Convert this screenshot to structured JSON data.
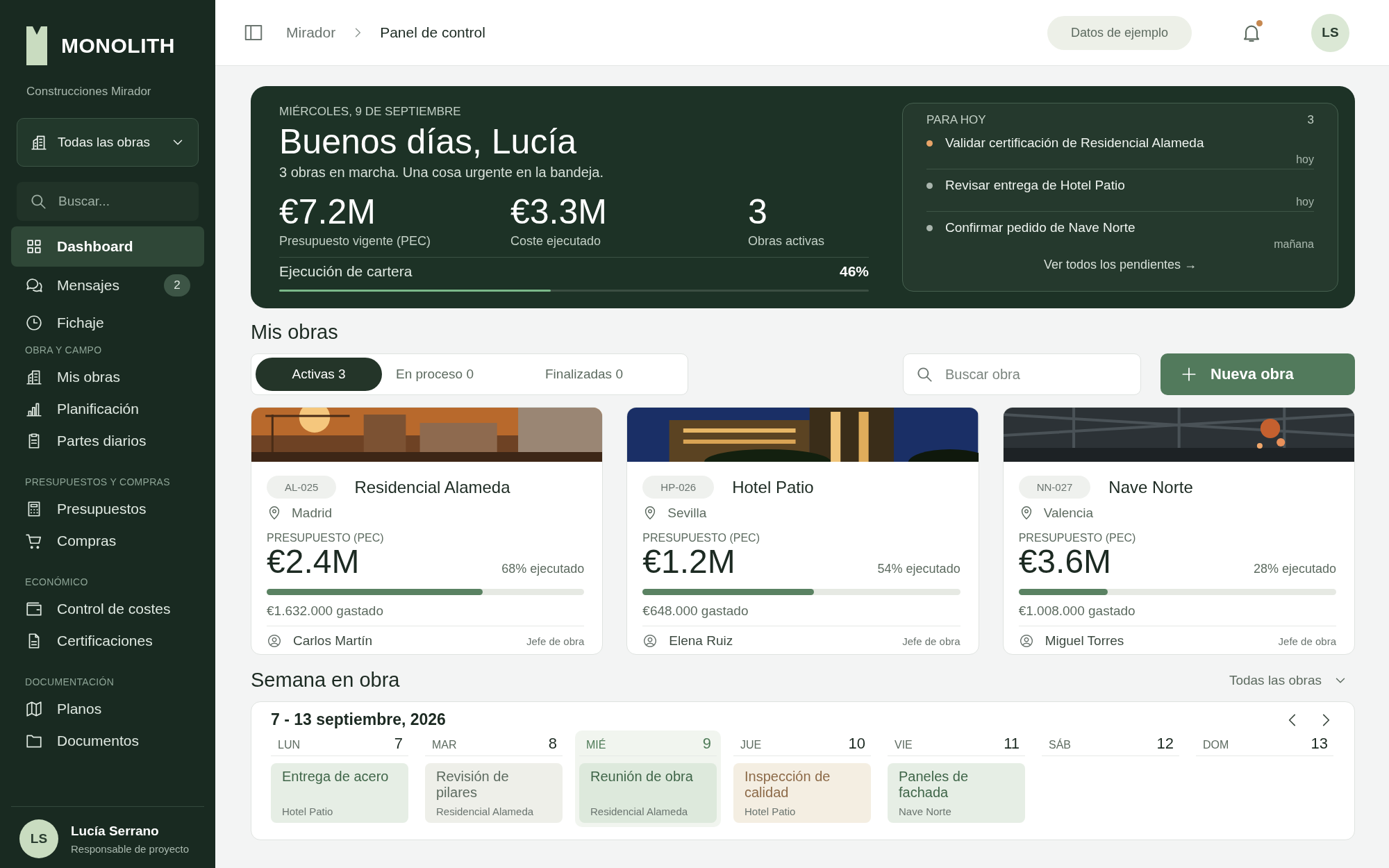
{
  "sidebar": {
    "brand": "MONOLITH",
    "company": "Construcciones Mirador",
    "project_selector": "Todas las obras",
    "search": {
      "placeholder": "Buscar..."
    },
    "sections": [
      {
        "items": [
          {
            "label": "Dashboard",
            "kind": "grid",
            "selected": true
          },
          {
            "label": "Mensajes",
            "kind": "chat",
            "selected": false,
            "badge": "2"
          },
          {
            "label": "Fichaje",
            "kind": "clock",
            "selected": false
          }
        ]
      },
      {
        "title": "OBRA Y CAMPO",
        "items": [
          {
            "label": "Mis obras",
            "kind": "building",
            "selected": false
          },
          {
            "label": "Planificación",
            "kind": "chart",
            "selected": false
          },
          {
            "label": "Partes diarios",
            "kind": "clipboard",
            "selected": false
          }
        ]
      },
      {
        "title": "PRESUPUESTOS Y COMPRAS",
        "items": [
          {
            "label": "Presupuestos",
            "kind": "calculator",
            "selected": false
          },
          {
            "label": "Compras",
            "kind": "cart",
            "selected": false
          }
        ]
      },
      {
        "title": "ECONÓMICO",
        "items": [
          {
            "label": "Control de costes",
            "kind": "wallet",
            "selected": false
          },
          {
            "label": "Certificaciones",
            "kind": "doc",
            "selected": false
          }
        ]
      },
      {
        "title": "DOCUMENTACIÓN",
        "items": [
          {
            "label": "Planos",
            "kind": "map",
            "selected": false
          },
          {
            "label": "Documentos",
            "kind": "folder",
            "selected": false
          }
        ]
      }
    ],
    "user": {
      "initials": "LS",
      "name": "Lucía Serrano",
      "role": "Responsable de proyecto"
    }
  },
  "header": {
    "breadcrumbs": [
      "Mirador",
      "Panel de control"
    ],
    "sample_badge": "Datos de ejemplo",
    "notifications_unread": true,
    "avatar": "LS"
  },
  "hero": {
    "date": "MIÉRCOLES, 9 DE SEPTIEMBRE",
    "greeting": "Buenos días, Lucía",
    "summary": "3 obras en marcha. Una cosa urgente en la bandeja.",
    "stats": [
      {
        "value": "€7.2M",
        "label": "Presupuesto vigente (PEC)"
      },
      {
        "value": "€3.3M",
        "label": "Coste ejecutado"
      },
      {
        "value": "3",
        "label": "Obras activas"
      }
    ],
    "progress": {
      "label": "Ejecución de cartera",
      "reading": "46%",
      "level": 0.46
    },
    "today": {
      "title": "PARA HOY",
      "count": "3",
      "items": [
        {
          "text": "Validar certificación de Residencial Alameda",
          "when": "hoy",
          "color": "#e8a468"
        },
        {
          "text": "Revisar entrega de Hotel Patio",
          "when": "hoy",
          "color": "#a9b5ad"
        },
        {
          "text": "Confirmar pedido de Nave Norte",
          "when": "mañana",
          "color": "#a9b5ad"
        }
      ],
      "link": "Ver todos los pendientes →"
    }
  },
  "projects": {
    "title": "Mis obras",
    "tabs": [
      {
        "label": "Activas 3",
        "selected": true
      },
      {
        "label": "En proceso 0",
        "selected": false
      },
      {
        "label": "Finalizadas 0",
        "selected": false
      }
    ],
    "search": {
      "placeholder": "Buscar obra"
    },
    "new_button": "Nueva obra",
    "cards": [
      {
        "code": "AL-025",
        "name": "Residencial Alameda",
        "city": "Madrid",
        "budget_label": "PRESUPUESTO (PEC)",
        "budget": "€2.4M",
        "executed": "68% ejecutado",
        "level": 0.68,
        "spent": "€1.632.000 gastado",
        "manager": "Carlos Martín",
        "role": "Jefe de obra"
      },
      {
        "code": "HP-026",
        "name": "Hotel Patio",
        "city": "Sevilla",
        "budget_label": "PRESUPUESTO (PEC)",
        "budget": "€1.2M",
        "executed": "54% ejecutado",
        "level": 0.54,
        "spent": "€648.000 gastado",
        "manager": "Elena Ruiz",
        "role": "Jefe de obra"
      },
      {
        "code": "NN-027",
        "name": "Nave Norte",
        "city": "Valencia",
        "budget_label": "PRESUPUESTO (PEC)",
        "budget": "€3.6M",
        "executed": "28% ejecutado",
        "level": 0.28,
        "spent": "€1.008.000 gastado",
        "manager": "Miguel Torres",
        "role": "Jefe de obra"
      }
    ]
  },
  "week": {
    "title": "Semana en obra",
    "filter": "Todas las obras",
    "range": "7 - 13 septiembre, 2026",
    "days": [
      {
        "name": "LUN",
        "date": "7",
        "selected": false,
        "events": [
          {
            "title": "Entrega de acero",
            "place": "Hotel Patio",
            "color": "#e6eee5"
          }
        ]
      },
      {
        "name": "MAR",
        "date": "8",
        "selected": false,
        "events": [
          {
            "title": "Revisión de pilares",
            "place": "Residencial Alameda",
            "color": "#eeefe9"
          }
        ]
      },
      {
        "name": "MIÉ",
        "date": "9",
        "selected": true,
        "events": [
          {
            "title": "Reunión de obra",
            "place": "Residencial Alameda",
            "color": "#dde9dc"
          }
        ]
      },
      {
        "name": "JUE",
        "date": "10",
        "selected": false,
        "events": [
          {
            "title": "Inspección de calidad",
            "place": "Hotel Patio",
            "color": "#f4eee2"
          }
        ]
      },
      {
        "name": "VIE",
        "date": "11",
        "selected": false,
        "events": [
          {
            "title": "Paneles de fachada",
            "place": "Nave Norte",
            "color": "#e6eee5"
          }
        ]
      },
      {
        "name": "SÁB",
        "date": "12",
        "selected": false
      },
      {
        "name": "DOM",
        "date": "13",
        "selected": false
      }
    ]
  }
}
